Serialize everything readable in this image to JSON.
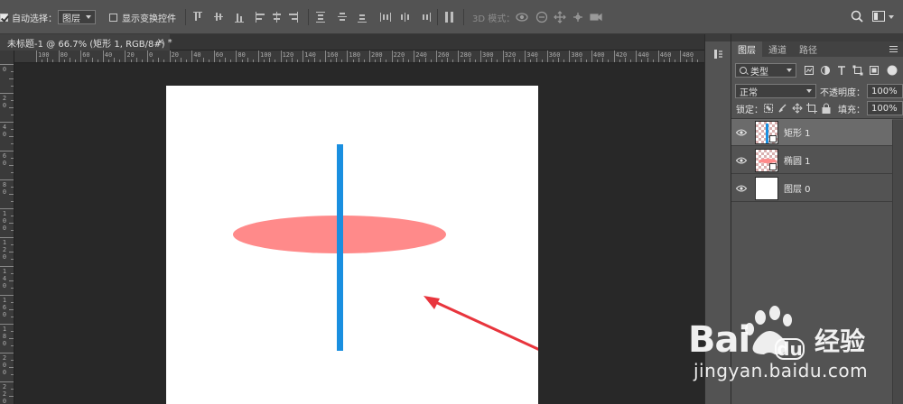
{
  "options_bar": {
    "auto_select_label": "自动选择：",
    "auto_select_checked": true,
    "auto_select_target": "图层",
    "show_transform_label": "显示变换控件",
    "show_transform_checked": false,
    "mode_3d_label": "3D 模式："
  },
  "document": {
    "tab_title": "未标题-1 @ 66.7% (矩形 1, RGB/8#)",
    "tab_modified_marker": "*",
    "close_glyph": "×"
  },
  "rulers": {
    "horizontal_labels": [
      "100",
      "80",
      "60",
      "40",
      "20",
      "0",
      "20",
      "40",
      "60",
      "80",
      "100",
      "120",
      "140",
      "160",
      "180",
      "200",
      "220",
      "240",
      "260",
      "280",
      "300",
      "320",
      "340",
      "360",
      "380",
      "400",
      "420",
      "440",
      "460",
      "480",
      "500",
      "520",
      "540",
      "560"
    ],
    "vertical_labels": [
      "0",
      "2 0",
      "4 0",
      "6 0",
      "8 0",
      "1 0 0",
      "1 2 0",
      "1 4 0",
      "1 6 0",
      "1 8 0",
      "2 0 0",
      "2 2 0"
    ]
  },
  "canvas": {
    "background": "#ffffff",
    "ellipse_color": "#ff8a8a",
    "rect_color": "#1a8fe0",
    "arrow_color": "#e8353d"
  },
  "layers_panel": {
    "tabs": [
      {
        "label": "图层",
        "active": true
      },
      {
        "label": "通道",
        "active": false
      },
      {
        "label": "路径",
        "active": false
      }
    ],
    "filter_label": "类型",
    "blend_mode": "正常",
    "opacity_label": "不透明度：",
    "opacity_value": "100%",
    "lock_label": "锁定：",
    "fill_label": "填充：",
    "fill_value": "100%",
    "layers": [
      {
        "name": "矩形 1",
        "selected": true,
        "visible": true
      },
      {
        "name": "椭圆 1",
        "selected": false,
        "visible": true
      },
      {
        "name": "图层 0",
        "selected": false,
        "visible": true
      }
    ]
  },
  "watermark": {
    "brand_latin": "Bai",
    "brand_du": "du",
    "brand_cn": "经验",
    "url": "jingyan.baidu.com"
  }
}
